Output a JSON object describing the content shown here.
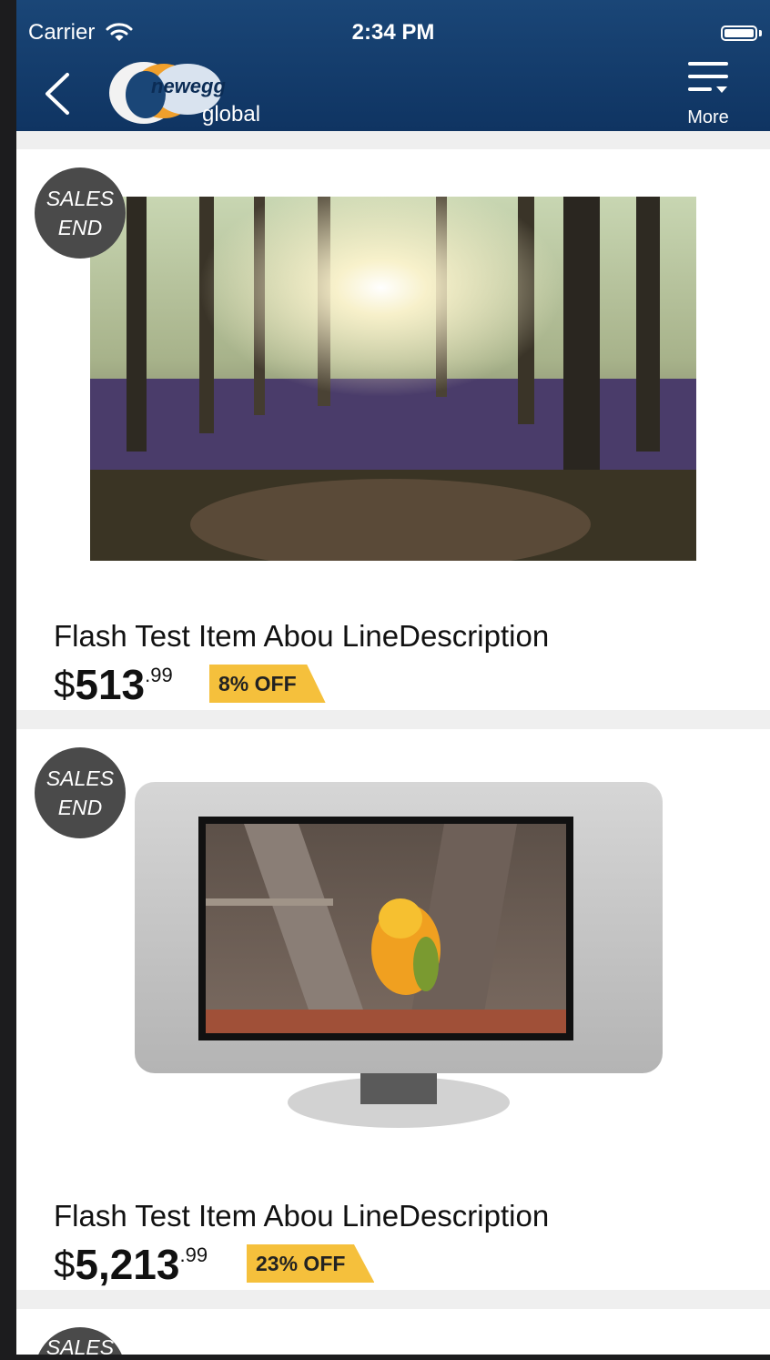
{
  "status_bar": {
    "carrier": "Carrier",
    "time": "2:34 PM"
  },
  "header": {
    "logo_word": "newegg",
    "logo_sub": "global",
    "more_label": "More"
  },
  "products": [
    {
      "badge_line1": "SALES",
      "badge_line2": "END",
      "title": "Flash Test Item Abou LineDescription",
      "currency": "$",
      "price_int": "513",
      "price_cents": ".99",
      "discount": "8% OFF"
    },
    {
      "badge_line1": "SALES",
      "badge_line2": "END",
      "title": "Flash Test Item Abou LineDescription",
      "currency": "$",
      "price_int": "5,213",
      "price_cents": ".99",
      "discount": "23% OFF"
    },
    {
      "badge_line1": "SALES"
    }
  ],
  "colors": {
    "header": "#123a69",
    "badge": "#4a4a4a",
    "discount": "#f5c03c"
  }
}
